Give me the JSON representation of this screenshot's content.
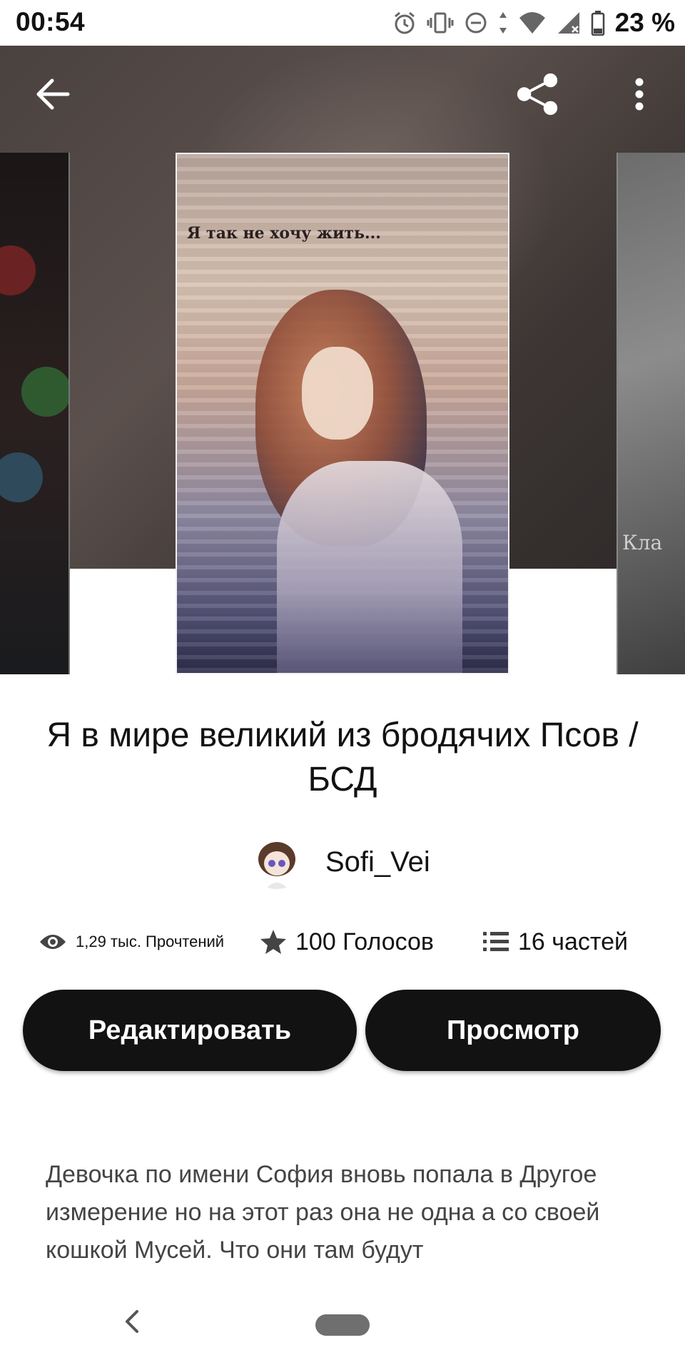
{
  "status_bar": {
    "time": "00:54",
    "battery": "23 %",
    "icons": [
      "alarm-icon",
      "vibrate-icon",
      "dnd-icon",
      "data-arrows-icon",
      "wifi-icon",
      "signal-icon",
      "battery-icon"
    ]
  },
  "toolbar": {
    "back_icon": "back-arrow-icon",
    "share_icon": "share-icon",
    "more_icon": "more-vert-icon"
  },
  "cover": {
    "main_text": "Я так не хочу жить...",
    "right_text": "Кла"
  },
  "story": {
    "title": "Я в мире великий из бродячих Псов /БСД",
    "author": "Sofi_Vei"
  },
  "stats": {
    "reads": "1,29 тыс. Прочтений",
    "votes": "100 Голосов",
    "parts": "16 частей"
  },
  "actions": {
    "edit_label": "Редактировать",
    "view_label": "Просмотр"
  },
  "description": "Девочка по имени София вновь попала в Другое измерение но на этот раз она не одна а со своей кошкой Мусей. Что они там будут",
  "colors": {
    "button_bg": "#121212",
    "text_primary": "#121212",
    "text_secondary": "#444444"
  }
}
